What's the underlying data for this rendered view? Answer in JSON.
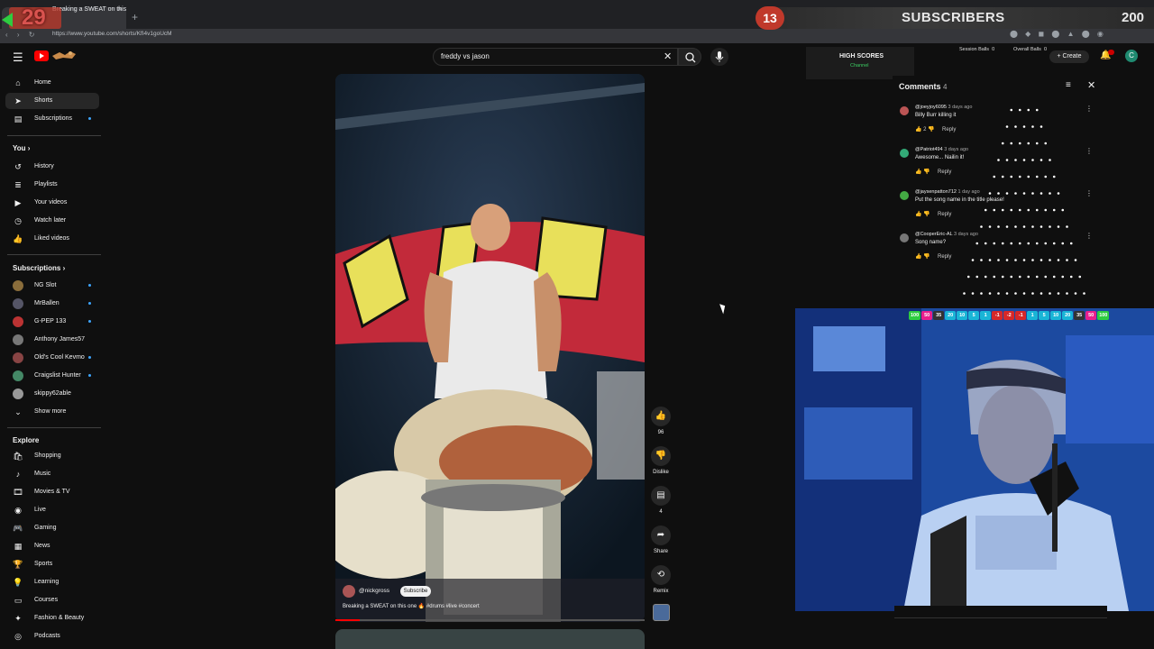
{
  "browser": {
    "tab_title": "Breaking a SWEAT on this",
    "tab_close": "×",
    "new_tab": "+",
    "url": "https://www.youtube.com/shorts/KfI4v1goUcM",
    "nav_icons": "‹ › ↻"
  },
  "overlay": {
    "counter": "29",
    "subscribers_count": "13",
    "subscribers_label": "SUBSCRIBERS",
    "subscribers_goal": "200",
    "high_scores_title": "HIGH SCORES",
    "high_scores_sub": "Channel",
    "session_balls_label": "Session Balls",
    "session_balls_value": "0",
    "overall_balls_label": "Overall Balls",
    "overall_balls_value": "0",
    "ball_strip": [
      {
        "v": "100",
        "c": "#2ecc40"
      },
      {
        "v": "50",
        "c": "#e91e8c"
      },
      {
        "v": "35",
        "c": "#333"
      },
      {
        "v": "20",
        "c": "#19b5d6"
      },
      {
        "v": "10",
        "c": "#19b5d6"
      },
      {
        "v": "5",
        "c": "#19b5d6"
      },
      {
        "v": "1",
        "c": "#19b5d6"
      },
      {
        "v": "-1",
        "c": "#d62828"
      },
      {
        "v": "-2",
        "c": "#d62828"
      },
      {
        "v": "-1",
        "c": "#d62828"
      },
      {
        "v": "1",
        "c": "#19b5d6"
      },
      {
        "v": "5",
        "c": "#19b5d6"
      },
      {
        "v": "10",
        "c": "#19b5d6"
      },
      {
        "v": "20",
        "c": "#19b5d6"
      },
      {
        "v": "35",
        "c": "#333"
      },
      {
        "v": "50",
        "c": "#e91e8c"
      },
      {
        "v": "100",
        "c": "#2ecc40"
      }
    ]
  },
  "header": {
    "search_value": "freddy vs jason",
    "create_label": "+ Create",
    "avatar_letter": "C"
  },
  "sidebar": {
    "main": [
      {
        "label": "Home",
        "icon": "⌂",
        "name": "home"
      },
      {
        "label": "Shorts",
        "icon": "➤",
        "name": "shorts",
        "active": true
      },
      {
        "label": "Subscriptions",
        "icon": "▤",
        "name": "subscriptions",
        "dot": true
      }
    ],
    "you_label": "You ›",
    "you": [
      {
        "label": "History",
        "icon": "↺",
        "name": "history"
      },
      {
        "label": "Playlists",
        "icon": "≣",
        "name": "playlists"
      },
      {
        "label": "Your videos",
        "icon": "▶",
        "name": "your-videos"
      },
      {
        "label": "Watch later",
        "icon": "◷",
        "name": "watch-later"
      },
      {
        "label": "Liked videos",
        "icon": "👍",
        "name": "liked-videos"
      }
    ],
    "subs_label": "Subscriptions ›",
    "subs": [
      {
        "label": "NG Slot",
        "color": "#8a6d3b",
        "dot": true
      },
      {
        "label": "MrBallen",
        "color": "#556",
        "dot": true
      },
      {
        "label": "G-PEP 133",
        "color": "#b33",
        "dot": true
      },
      {
        "label": "Anthony James57",
        "color": "#777",
        "dot": false
      },
      {
        "label": "Old's Cool Kevmo",
        "color": "#844",
        "dot": true
      },
      {
        "label": "Craigslist Hunter",
        "color": "#486",
        "dot": true
      },
      {
        "label": "skippy62able",
        "color": "#999",
        "dot": false
      }
    ],
    "show_more": "Show more",
    "explore_label": "Explore",
    "explore": [
      {
        "label": "Shopping",
        "icon": "🛍",
        "name": "shopping"
      },
      {
        "label": "Music",
        "icon": "♪",
        "name": "music"
      },
      {
        "label": "Movies & TV",
        "icon": "🎞",
        "name": "movies-tv"
      },
      {
        "label": "Live",
        "icon": "◉",
        "name": "live"
      },
      {
        "label": "Gaming",
        "icon": "🎮",
        "name": "gaming"
      },
      {
        "label": "News",
        "icon": "▦",
        "name": "news"
      },
      {
        "label": "Sports",
        "icon": "🏆",
        "name": "sports"
      },
      {
        "label": "Learning",
        "icon": "💡",
        "name": "learning"
      },
      {
        "label": "Courses",
        "icon": "▭",
        "name": "courses"
      },
      {
        "label": "Fashion & Beauty",
        "icon": "✦",
        "name": "fashion-beauty"
      },
      {
        "label": "Podcasts",
        "icon": "◎",
        "name": "podcasts"
      }
    ]
  },
  "video": {
    "channel": "@nickgross",
    "subscribe": "Subscribe",
    "caption": "Breaking a SWEAT on this one 🔥 #drums #live #concert",
    "progress": 0.08,
    "likes": "96",
    "dislike": "Dislike",
    "comments": "4",
    "share": "Share",
    "remix": "Remix"
  },
  "comments": {
    "title": "Comments",
    "count": "4",
    "items": [
      {
        "author": "@joeyjoy6095",
        "time": "3 days ago",
        "text": "Billy Burr killing it",
        "likes": "2",
        "color": "#b55"
      },
      {
        "author": "@Patriot494",
        "time": "3 days ago",
        "text": "Awesome... Nailin it!",
        "likes": "",
        "color": "#3a7"
      },
      {
        "author": "@jaysenpatton712",
        "time": "1 day ago",
        "text": "Put the song name in the title please!",
        "likes": "",
        "color": "#4a4"
      },
      {
        "author": "@CooperEric-AL",
        "time": "3 days ago",
        "text": "Song name?",
        "likes": "",
        "color": "#777"
      }
    ],
    "reply": "Reply"
  }
}
